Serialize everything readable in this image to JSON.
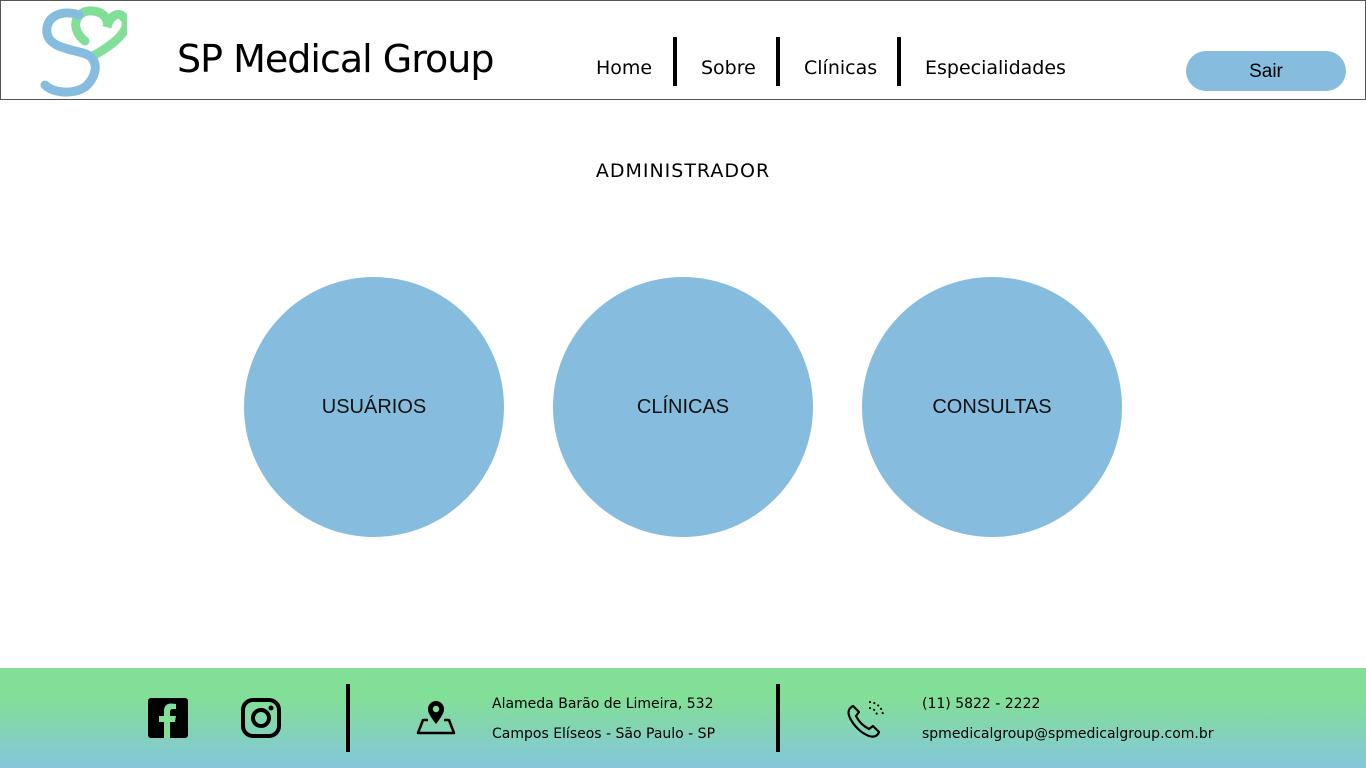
{
  "header": {
    "brand": "SP Medical Group",
    "nav": [
      "Home",
      "Sobre",
      "Clínicas",
      "Especialidades"
    ],
    "logout_label": "Sair"
  },
  "main": {
    "title": "ADMINISTRADOR",
    "cards": [
      "USUÁRIOS",
      "CLÍNICAS",
      "CONSULTAS"
    ]
  },
  "footer": {
    "address_line1": "Alameda Barão de Limeira, 532",
    "address_line2": "Campos Elíseos - São Paulo - SP",
    "phone": "(11) 5822 - 2222",
    "email": "spmedicalgroup@spmedicalgroup.com.br"
  },
  "colors": {
    "accent_blue": "#86bddf",
    "accent_green": "#82df97"
  },
  "icons": [
    "logo-icon",
    "facebook-icon",
    "instagram-icon",
    "map-pin-icon",
    "phone-icon"
  ]
}
